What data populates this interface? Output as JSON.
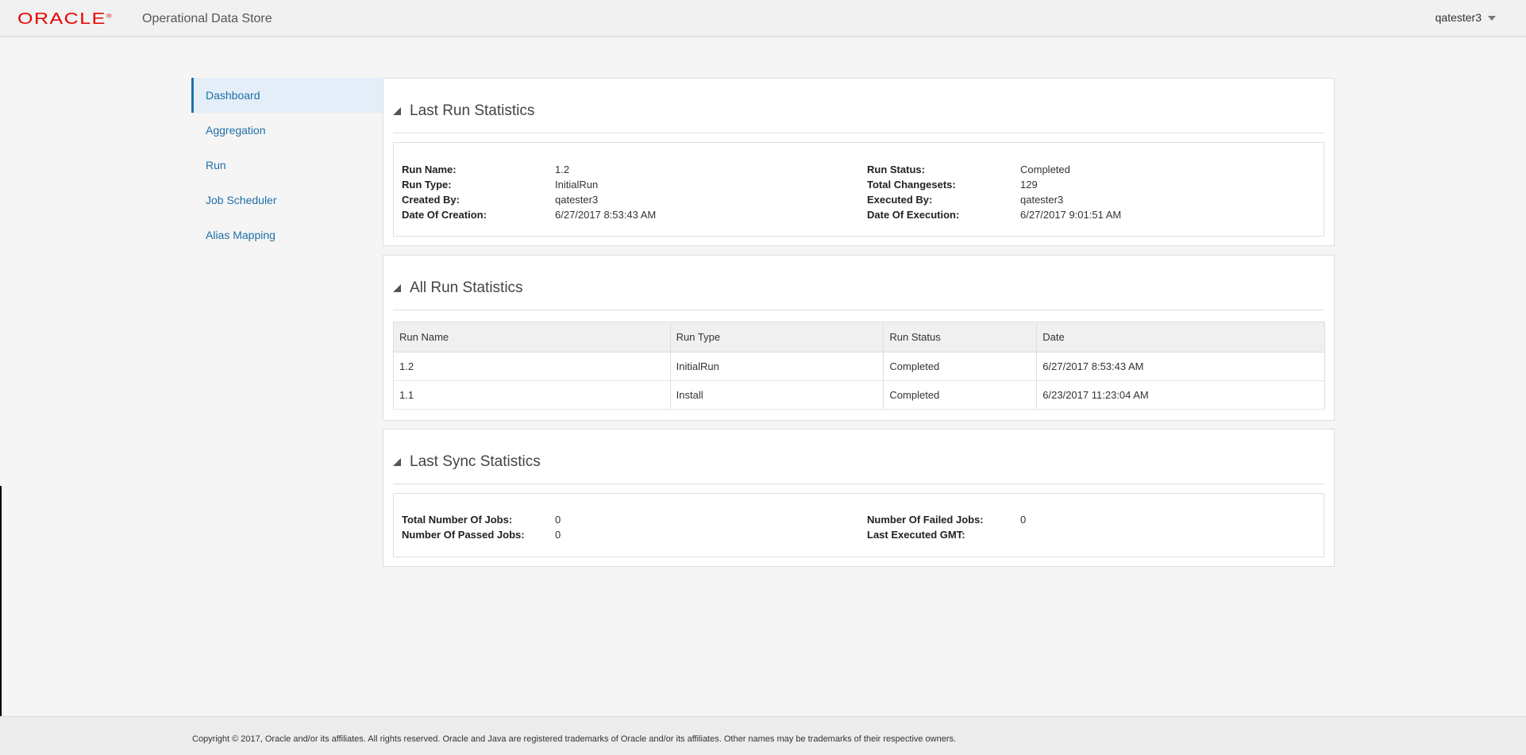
{
  "header": {
    "logo": "ORACLE",
    "logo_mark": "®",
    "app_title": "Operational Data Store",
    "user": "qatester3"
  },
  "colors": {
    "brand": "#e60000",
    "link": "#1f6fa8",
    "nav_active_bg": "#e4eef8"
  },
  "sidebar": {
    "items": [
      {
        "label": "Dashboard",
        "active": true
      },
      {
        "label": "Aggregation"
      },
      {
        "label": "Run"
      },
      {
        "label": "Job Scheduler"
      },
      {
        "label": "Alias Mapping"
      }
    ]
  },
  "last_run": {
    "title": "Last Run Statistics",
    "left": [
      {
        "key": "Run Name:",
        "value": "1.2"
      },
      {
        "key": "Run Type:",
        "value": "InitialRun"
      },
      {
        "key": "Created By:",
        "value": "qatester3"
      },
      {
        "key": "Date Of Creation:",
        "value": "6/27/2017 8:53:43 AM"
      }
    ],
    "right": [
      {
        "key": "Run Status:",
        "value": "Completed"
      },
      {
        "key": "Total Changesets:",
        "value": "129"
      },
      {
        "key": "Executed By:",
        "value": "qatester3"
      },
      {
        "key": "Date Of Execution:",
        "value": "6/27/2017 9:01:51 AM"
      }
    ]
  },
  "all_runs": {
    "title": "All Run Statistics",
    "columns": [
      "Run Name",
      "Run Type",
      "Run Status",
      "Date"
    ],
    "rows": [
      [
        "1.2",
        "InitialRun",
        "Completed",
        "6/27/2017 8:53:43 AM"
      ],
      [
        "1.1",
        "Install",
        "Completed",
        "6/23/2017 11:23:04 AM"
      ]
    ]
  },
  "last_sync": {
    "title": "Last Sync Statistics",
    "left": [
      {
        "key": "Total Number Of Jobs:",
        "value": "0"
      },
      {
        "key": "Number Of Passed Jobs:",
        "value": "0"
      }
    ],
    "right": [
      {
        "key": "Number Of Failed Jobs:",
        "value": "0"
      },
      {
        "key": "Last Executed GMT:",
        "value": ""
      }
    ]
  },
  "footer": {
    "text": "Copyright © 2017, Oracle and/or its affiliates. All rights reserved. Oracle and Java are registered trademarks of Oracle and/or its affiliates. Other names may be trademarks of their respective owners."
  }
}
